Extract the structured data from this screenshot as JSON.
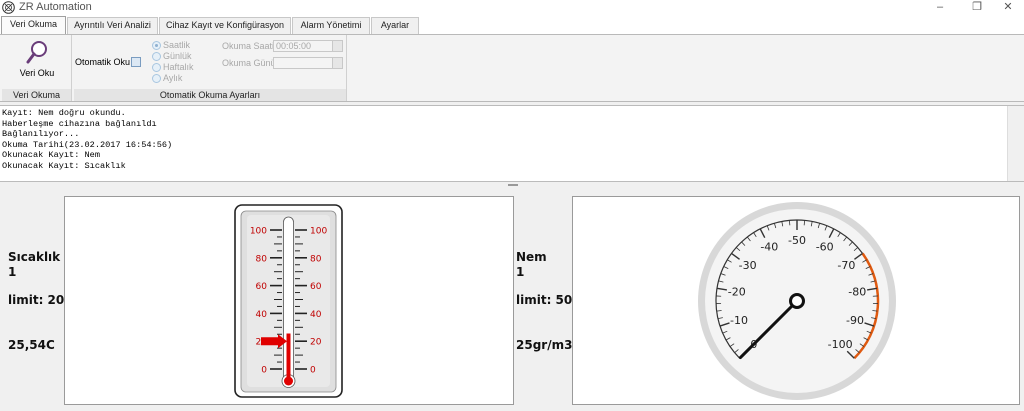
{
  "window": {
    "title": "ZR Automation",
    "minimize": "–",
    "restore": "❐",
    "close": "✕"
  },
  "tabs": [
    "Veri Okuma",
    "Ayrıntılı Veri Analizi",
    "Cihaz Kayıt ve Konfigürasyon",
    "Alarm Yönetimi",
    "Ayarlar"
  ],
  "ribbon": {
    "read_button_label": "Veri Oku",
    "read_group_label": "Veri Okuma",
    "auto_read_label": "Otomatik Oku",
    "interval_options": [
      "Saatlik",
      "Günlük",
      "Haftalık",
      "Aylık"
    ],
    "selected_interval": "Saatlik",
    "read_time_label": "Okuma Saati",
    "read_time_value": "00:05:00",
    "read_day_label": "Okuma Günü",
    "read_day_value": "",
    "auto_group_label": "Otomatik Okuma Ayarları"
  },
  "log": [
    "Kayıt: Nem doğru okundu.",
    "Haberleşme cihazına bağlanıldı",
    "Bağlanılıyor...",
    "Okuma Tarihi(23.02.2017 16:54:56)",
    "Okunacak Kayıt: Nem",
    "Okunacak Kayıt: Sıcaklık"
  ],
  "temperature": {
    "name": "Sıcaklık",
    "id": "1",
    "limit_text": "limit: 20",
    "value_text": "25,54C",
    "value": 25.54,
    "limit": 20,
    "scale_min": 0,
    "scale_max": 100,
    "tick_labels": [
      "100",
      "80",
      "60",
      "40",
      "20",
      "0"
    ],
    "colors": {
      "mercury": "#e00000",
      "scale_text": "#c00000"
    }
  },
  "humidity": {
    "name": "Nem",
    "id": "1",
    "limit_text": "limit: 50",
    "value_text": "25gr/m3",
    "dial_labels": [
      "0",
      "-10",
      "-20",
      "-30",
      "-40",
      "-50",
      "-60",
      "-70",
      "-80",
      "-90",
      "-100"
    ],
    "needle_value": 0,
    "colors": {
      "danger_arc": "#e05a10"
    }
  }
}
